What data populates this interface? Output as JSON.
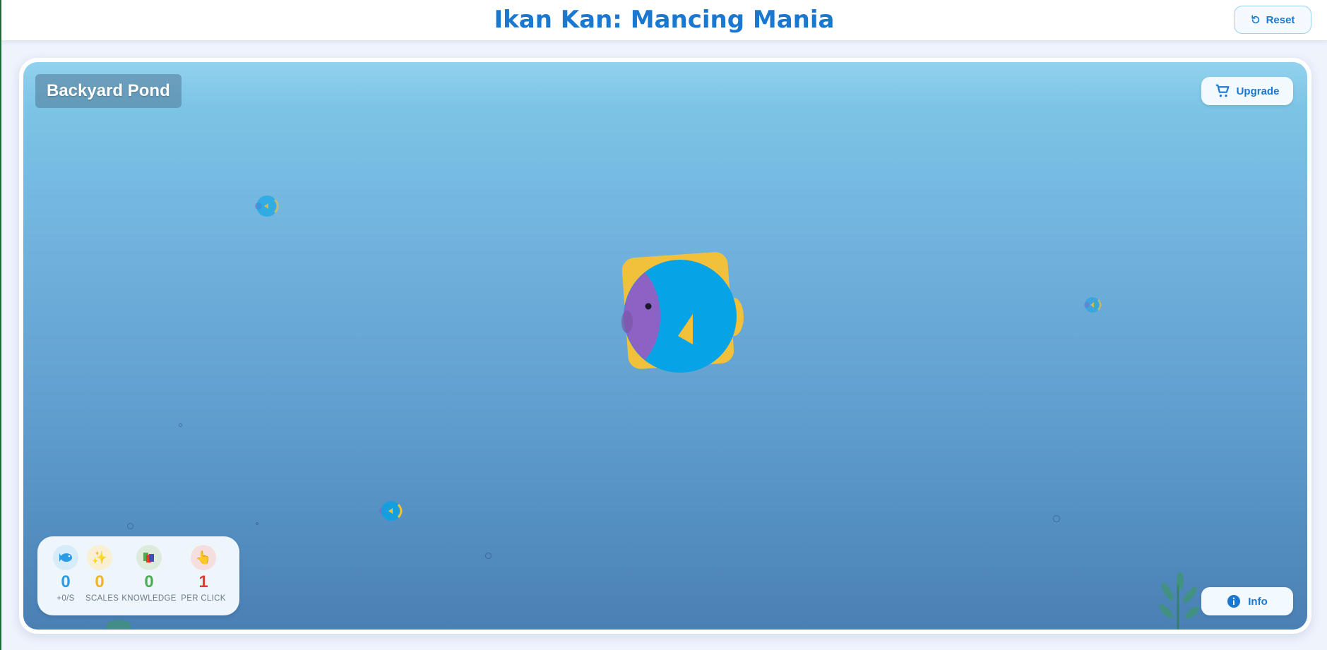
{
  "header": {
    "title": "Ikan Kan: Mancing Mania",
    "reset_label": "Reset",
    "reset_icon": "refresh-icon"
  },
  "pond": {
    "location_name": "Backyard Pond",
    "upgrade_label": "Upgrade",
    "upgrade_icon": "cart-icon",
    "info_label": "Info",
    "info_icon": "info-icon"
  },
  "stats": [
    {
      "icon": "fish-icon",
      "value": "0",
      "label": "+0/S",
      "color": "#2b9be6"
    },
    {
      "icon": "sparkles-icon",
      "value": "0",
      "label": "SCALES",
      "color": "#f0b429"
    },
    {
      "icon": "books-icon",
      "value": "0",
      "label": "KNOWLEDGE",
      "color": "#4caf50"
    },
    {
      "icon": "pointer-hand-icon",
      "value": "1",
      "label": "PER CLICK",
      "color": "#e53935"
    }
  ],
  "colors": {
    "accent": "#1a78d0",
    "fish_body": "#06a3e6",
    "fish_fin": "#f2c13c",
    "fish_head": "#8d62c5"
  }
}
